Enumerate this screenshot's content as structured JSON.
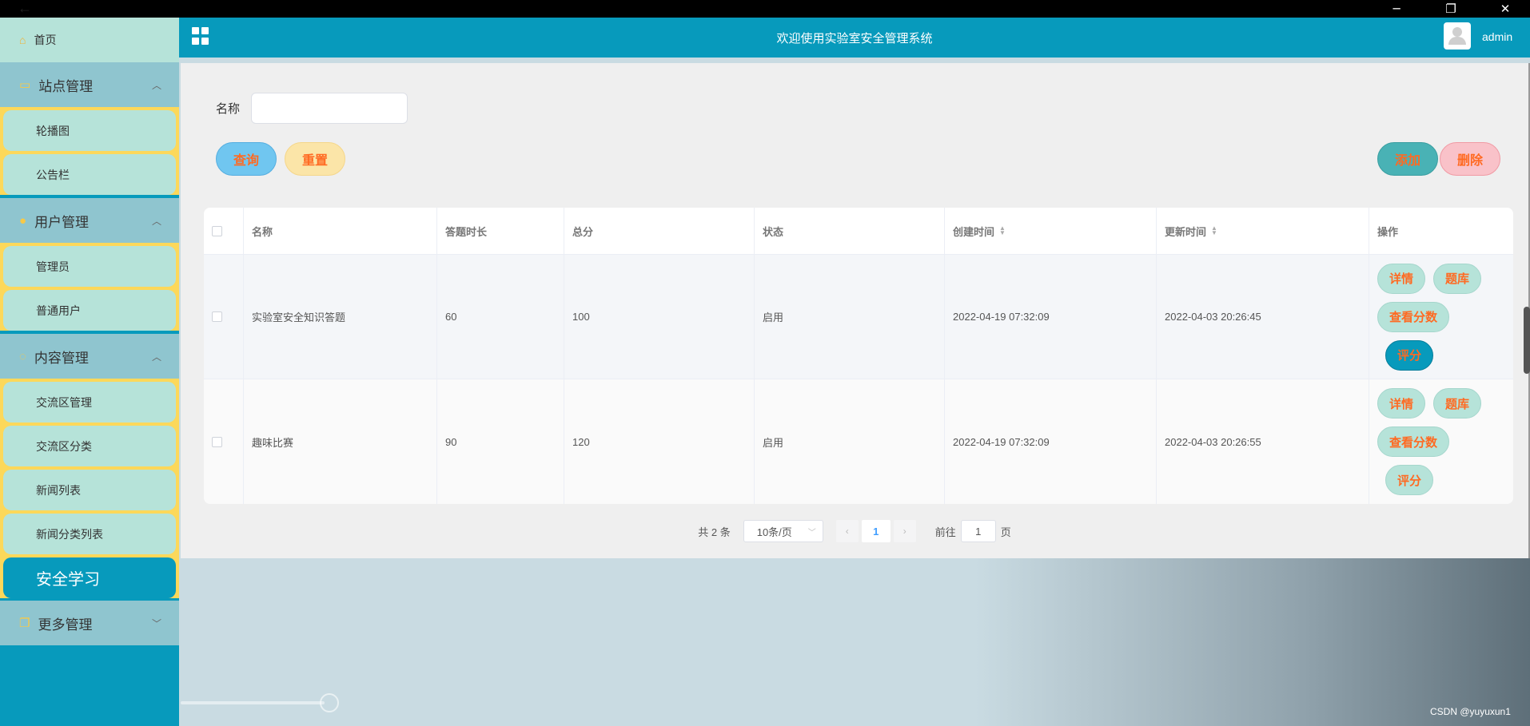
{
  "window": {
    "back_icon": "arrow-left-icon",
    "minimize": "─",
    "restore": "❐",
    "close": "✕"
  },
  "sidebar": {
    "home": "首页",
    "groups": [
      {
        "label": "站点管理",
        "icon": "monitor-icon",
        "items": [
          "轮播图",
          "公告栏"
        ]
      },
      {
        "label": "用户管理",
        "icon": "user-icon",
        "items": [
          "管理员",
          "普通用户"
        ]
      },
      {
        "label": "内容管理",
        "icon": "chat-icon",
        "items": [
          "交流区管理",
          "交流区分类",
          "新闻列表",
          "新闻分类列表",
          "安全学习"
        ]
      },
      {
        "label": "更多管理",
        "icon": "copy-icon",
        "items": []
      }
    ],
    "active_item": "安全学习"
  },
  "header": {
    "title": "欢迎使用实验室安全管理系统",
    "user": "admin"
  },
  "filter": {
    "name_label": "名称",
    "name_value": ""
  },
  "buttons": {
    "query": "查询",
    "reset": "重置",
    "add": "添加",
    "delete": "删除"
  },
  "table": {
    "columns": [
      "名称",
      "答题时长",
      "总分",
      "状态",
      "创建时间",
      "更新时间",
      "操作"
    ],
    "rows": [
      {
        "name": "实验室安全知识答题",
        "duration": "60",
        "score": "100",
        "status": "启用",
        "created": "2022-04-19 07:32:09",
        "updated": "2022-04-03 20:26:45"
      },
      {
        "name": "趣味比赛",
        "duration": "90",
        "score": "120",
        "status": "启用",
        "created": "2022-04-19 07:32:09",
        "updated": "2022-04-03 20:26:55"
      }
    ],
    "op_labels": {
      "detail": "详情",
      "bank": "题库",
      "view_score": "查看分数",
      "grade": "评分",
      "grade_partial": "评分"
    }
  },
  "pager": {
    "total": "共 2 条",
    "page_size": "10条/页",
    "current_page": "1",
    "goto_label": "前往",
    "goto_value": "1",
    "page_suffix": "页"
  },
  "watermark": "CSDN @yuyuxun1"
}
